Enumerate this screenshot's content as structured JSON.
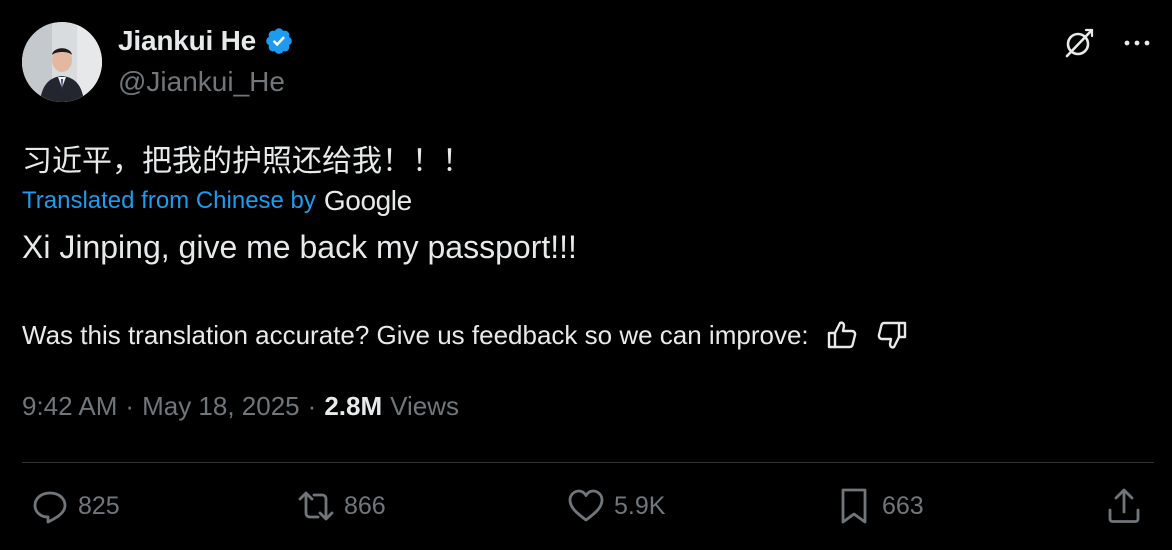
{
  "author": {
    "display_name": "Jiankui He",
    "handle": "@Jiankui_He",
    "verified": true
  },
  "post": {
    "original_text": "习近平，把我的护照还给我！！！",
    "translated_label": "Translated from Chinese by",
    "translator_brand": "Google",
    "translation": "Xi Jinping, give me back my passport!!!",
    "feedback_prompt": "Was this translation accurate? Give us feedback so we can improve:"
  },
  "meta": {
    "time": "9:42 AM",
    "separator": "·",
    "date": "May 18, 2025",
    "views_count": "2.8M",
    "views_label": "Views"
  },
  "actions": {
    "replies": "825",
    "reposts": "866",
    "likes": "5.9K",
    "bookmarks": "663"
  },
  "icons": {
    "verified": "verified-badge-icon",
    "grok": "grok-icon",
    "more": "more-icon",
    "thumbs_up": "thumbs-up-icon",
    "thumbs_down": "thumbs-down-icon",
    "reply": "reply-icon",
    "repost": "repost-icon",
    "like": "heart-icon",
    "bookmark": "bookmark-icon",
    "share": "share-icon"
  },
  "colors": {
    "background": "#000000",
    "text_primary": "#e7e9ea",
    "text_secondary": "#71767b",
    "accent_blue": "#1d9bf0",
    "divider": "#2f3336"
  }
}
